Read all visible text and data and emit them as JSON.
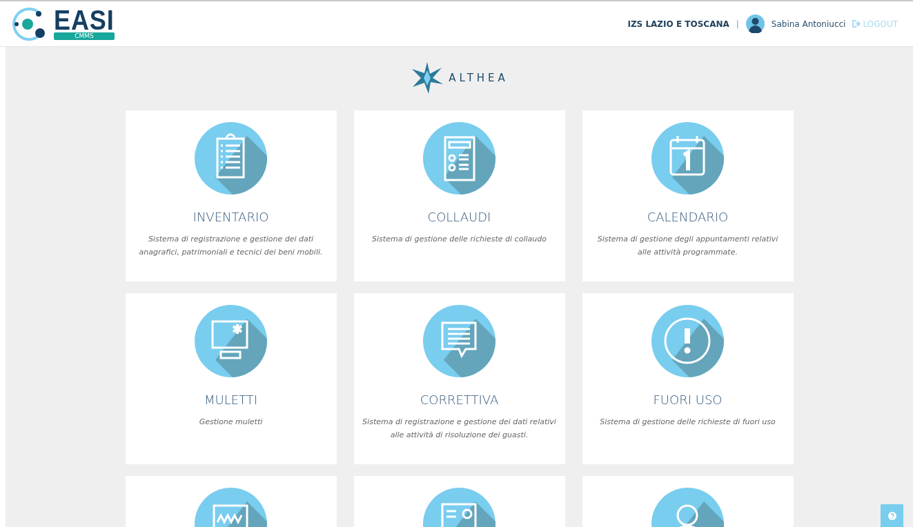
{
  "header": {
    "logo": {
      "word": "EASI",
      "tag": "CMMS"
    },
    "organization": "IZS LAZIO E TOSCANA",
    "separator": "|",
    "user": "Sabina Antoniucci",
    "logout": "LOGOUT"
  },
  "brand": "ALTHEA",
  "modules": [
    {
      "kind": "clipboard",
      "title": "INVENTARIO",
      "description": "Sistema di registrazione e gestione dei dati anagrafici, patrimoniali e tecnici dei beni mobili."
    },
    {
      "kind": "form",
      "title": "COLLAUDI",
      "description": "Sistema di gestione delle richieste di collaudo"
    },
    {
      "kind": "calendar",
      "title": "CALENDARIO",
      "description": "Sistema di gestione degli appuntamenti relativi alle attività programmate."
    },
    {
      "kind": "monitor",
      "title": "MULETTI",
      "description": "Gestione muletti"
    },
    {
      "kind": "comment",
      "title": "CORRETTIVA",
      "description": "Sistema di registrazione e gestione dei dati relativi alle attività di risoluzione dei guasti."
    },
    {
      "kind": "alert",
      "title": "FUORI USO",
      "description": "Sistema di gestione delle richieste di fuori uso"
    },
    {
      "kind": "chart"
    },
    {
      "kind": "document"
    },
    {
      "kind": "user"
    }
  ]
}
